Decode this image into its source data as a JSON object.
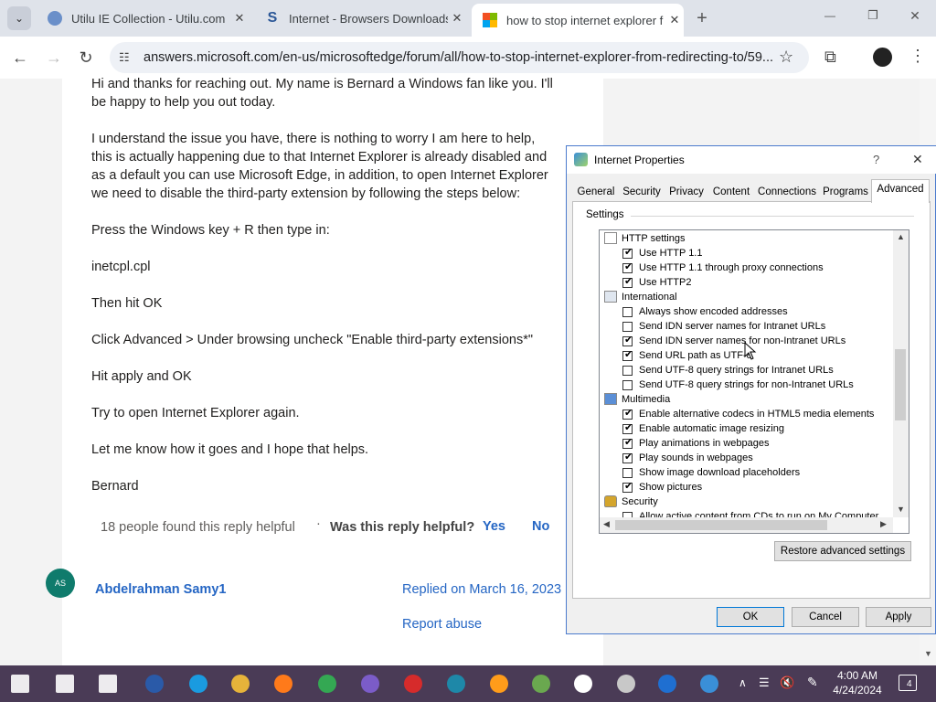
{
  "browser": {
    "tabs": [
      {
        "title": "Utilu IE Collection - Utilu.com",
        "close": "✕"
      },
      {
        "title": "Internet - Browsers Downloads",
        "close": "✕"
      },
      {
        "title": "how to stop internet explorer f",
        "close": "✕"
      }
    ],
    "new_tab": "+",
    "url": "answers.microsoft.com/en-us/microsoftedge/forum/all/how-to-stop-internet-explorer-from-redirecting-to/59...",
    "window": {
      "minimize": "—",
      "restore": "❐",
      "close": "✕"
    }
  },
  "post": {
    "paragraphs": [
      "Hi and thanks for reaching out. My name is Bernard a Windows fan like you. I'll",
      "be happy to help you out today.",
      "I understand the issue you have, there is nothing to worry I am here to help,",
      "this is actually happening due to that Internet Explorer is already disabled and",
      "as a default you can use Microsoft Edge, in addition, to open Internet Explorer",
      "we need to disable the third-party extension by following the steps below:",
      "Press the Windows key + R then type in:",
      "inetcpl.cpl",
      "Then hit OK",
      "Click Advanced > Under browsing uncheck \"Enable third-party extensions*\"",
      "Hit apply and OK",
      "Try to open Internet Explorer again.",
      "Let me know how it goes and I hope that helps.",
      "Bernard"
    ],
    "helpful_count": "18 people found this reply helpful",
    "separator": "·",
    "helpful_question": "Was this reply helpful?",
    "yes": "Yes",
    "no": "No"
  },
  "reply": {
    "avatar_initials": "AS",
    "author": "Abdelrahman Samy1",
    "replied": "Replied on March 16, 2023",
    "report": "Report abuse"
  },
  "dialog": {
    "title": "Internet Properties",
    "help": "?",
    "close": "✕",
    "tabs": [
      "General",
      "Security",
      "Privacy",
      "Content",
      "Connections",
      "Programs",
      "Advanced"
    ],
    "active_tab": "Advanced",
    "settings_label": "Settings",
    "items": [
      {
        "type": "category",
        "label": "HTTP settings",
        "icon": "page-icon"
      },
      {
        "type": "checkbox",
        "label": "Use HTTP 1.1",
        "checked": true
      },
      {
        "type": "checkbox",
        "label": "Use HTTP 1.1 through proxy connections",
        "checked": true
      },
      {
        "type": "checkbox",
        "label": "Use HTTP2",
        "checked": true
      },
      {
        "type": "category",
        "label": "International",
        "icon": "window-icon"
      },
      {
        "type": "checkbox",
        "label": "Always show encoded addresses",
        "checked": false
      },
      {
        "type": "checkbox",
        "label": "Send IDN server names for Intranet URLs",
        "checked": false
      },
      {
        "type": "checkbox",
        "label": "Send IDN server names for non-Intranet URLs",
        "checked": true
      },
      {
        "type": "checkbox",
        "label": "Send URL path as UTF-8",
        "checked": true
      },
      {
        "type": "checkbox",
        "label": "Send UTF-8 query strings for Intranet URLs",
        "checked": false
      },
      {
        "type": "checkbox",
        "label": "Send UTF-8 query strings for non-Intranet URLs",
        "checked": false
      },
      {
        "type": "category",
        "label": "Multimedia",
        "icon": "multimedia-icon"
      },
      {
        "type": "checkbox",
        "label": "Enable alternative codecs in HTML5 media elements",
        "checked": true
      },
      {
        "type": "checkbox",
        "label": "Enable automatic image resizing",
        "checked": true
      },
      {
        "type": "checkbox",
        "label": "Play animations in webpages",
        "checked": true
      },
      {
        "type": "checkbox",
        "label": "Play sounds in webpages",
        "checked": true
      },
      {
        "type": "checkbox",
        "label": "Show image download placeholders",
        "checked": false
      },
      {
        "type": "checkbox",
        "label": "Show pictures",
        "checked": true
      },
      {
        "type": "category",
        "label": "Security",
        "icon": "lock-icon"
      },
      {
        "type": "checkbox",
        "label": "Allow active content from CDs to run on My Computer",
        "checked": false
      }
    ],
    "restore_button": "Restore advanced settings",
    "ok": "OK",
    "cancel": "Cancel",
    "apply": "Apply"
  },
  "taskbar": {
    "time": "4:00 AM",
    "date": "4/24/2024",
    "notifications": "4",
    "apps": [
      "windows-start-icon",
      "search-icon",
      "task-view-icon",
      "obama-icon",
      "internet-explorer-icon",
      "file-explorer-icon",
      "firefox-icon",
      "chrome-icon",
      "visual-studio-icon",
      "fg-icon",
      "v-app-icon",
      "search-tool-icon",
      "notepad-icon",
      "settings-icon",
      "control-panel-icon",
      "ie-app-icon",
      "internet-options-icon"
    ]
  },
  "colors": {
    "accent_link": "#2566c4",
    "avatar_bg": "#0f7b6c",
    "taskbar_bg": "#4a3b56",
    "dialog_border": "#4b7bcd"
  }
}
